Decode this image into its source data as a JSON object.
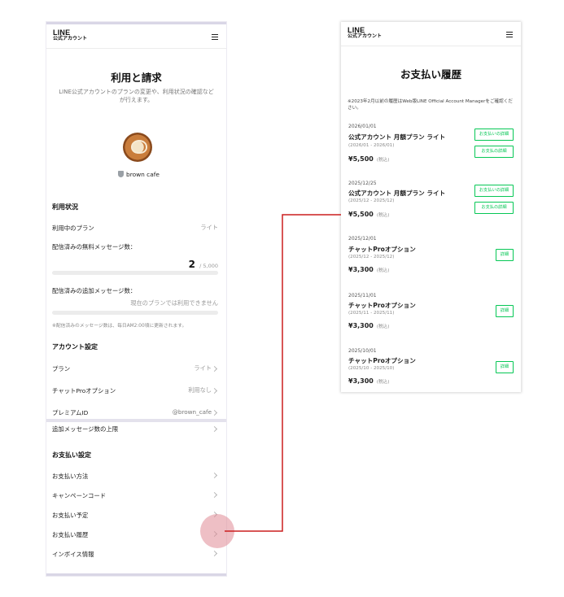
{
  "left": {
    "logo_line1": "LINE",
    "logo_line2": "公式アカウント",
    "menu_icon": "hamburger-icon",
    "title": "利用と請求",
    "subtitle": "LINE公式アカウントのプランの変更や、利用状況の確認などが行えます。",
    "account_name": "brown cafe",
    "usage_section": "利用状況",
    "current_plan_label": "利用中のプラン",
    "current_plan_value": "ライト",
    "free_msg_label": "配信済みの無料メッセージ数：",
    "free_msg_count": "2",
    "free_msg_limit": "/ 5,000",
    "free_msg_progress": 0.0004,
    "extra_msg_label": "配信済みの追加メッセージ数：",
    "extra_msg_value": "現在のプランでは利用できません",
    "usage_note": "※配信済みのメッセージ数は、毎日AM2:00頃に更新されます。",
    "account_section": "アカウント設定",
    "account_rows": [
      {
        "label": "プラン",
        "value": "ライト"
      },
      {
        "label": "チャットProオプション",
        "value": "利用なし"
      },
      {
        "label": "プレミアムID",
        "value": "@brown_cafe"
      },
      {
        "label": "追加メッセージ数の上限",
        "value": ""
      }
    ],
    "payment_section": "お支払い設定",
    "payment_rows": [
      {
        "label": "お支払い方法"
      },
      {
        "label": "キャンペーンコード"
      },
      {
        "label": "お支払い予定"
      },
      {
        "label": "お支払い履歴"
      },
      {
        "label": "インボイス情報"
      }
    ]
  },
  "right": {
    "logo_line1": "LINE",
    "logo_line2": "公式アカウント",
    "title": "お支払い履歴",
    "note": "※2023年2月以前の履歴はWeb版LINE Official Account Managerをご確認ください。",
    "entries": [
      {
        "date": "2026/01/01",
        "item": "公式アカウント 月額プラン ライト",
        "range": "(2026/01 - 2026/01)",
        "price": "¥5,500",
        "tax": "(税込)",
        "buttons": [
          "お支払いの詳細",
          "お支払の詳細"
        ]
      },
      {
        "date": "2025/12/25",
        "item": "公式アカウント 月額プラン ライト",
        "range": "(2025/12 - 2025/12)",
        "price": "¥5,500",
        "tax": "(税込)",
        "buttons": [
          "お支払いの詳細",
          "お支払の詳細"
        ]
      },
      {
        "date": "2025/12/01",
        "item": "チャットProオプション",
        "range": "(2025/12 - 2025/12)",
        "price": "¥3,300",
        "tax": "(税込)",
        "buttons": [
          "詳細"
        ]
      },
      {
        "date": "2025/11/01",
        "item": "チャットProオプション",
        "range": "(2025/11 - 2025/11)",
        "price": "¥3,300",
        "tax": "(税込)",
        "buttons": [
          "詳細"
        ]
      },
      {
        "date": "2025/10/01",
        "item": "チャットProオプション",
        "range": "(2025/10 - 2025/10)",
        "price": "¥3,300",
        "tax": "(税込)",
        "buttons": [
          "詳細"
        ]
      }
    ]
  },
  "colors": {
    "accent": "#06c755",
    "connector": "#cc1e1e",
    "highlight": "#e08a96"
  }
}
